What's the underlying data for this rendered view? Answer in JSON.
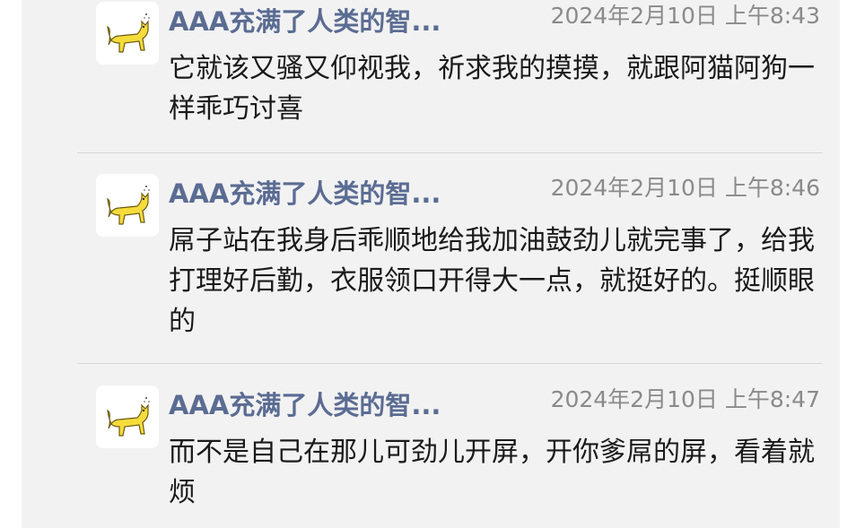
{
  "messages": [
    {
      "sender": "AAA充满了人类的智...",
      "time": "2024年2月10日 上午8:43",
      "text": "它就该又骚又仰视我，祈求我的摸摸，就跟阿猫阿狗一样乖巧讨喜",
      "avatar_icon": "yellow-cat-icon"
    },
    {
      "sender": "AAA充满了人类的智...",
      "time": "2024年2月10日 上午8:46",
      "text": "屌子站在我身后乖顺地给我加油鼓劲儿就完事了，给我打理好后勤，衣服领口开得大一点，就挺好的。挺顺眼的",
      "avatar_icon": "yellow-cat-icon"
    },
    {
      "sender": "AAA充满了人类的智...",
      "time": "2024年2月10日 上午8:47",
      "text": "而不是自己在那儿可劲儿开屏，开你爹屌的屏，看着就烦",
      "avatar_icon": "yellow-cat-icon"
    }
  ],
  "colors": {
    "panel_bg": "#f2f2f2",
    "sender_name": "#5b6c93",
    "timestamp": "#8a8a8a",
    "message_text": "#1a1a1a",
    "divider": "#d6d6d6",
    "cat_fill": "#f5dc3c"
  }
}
